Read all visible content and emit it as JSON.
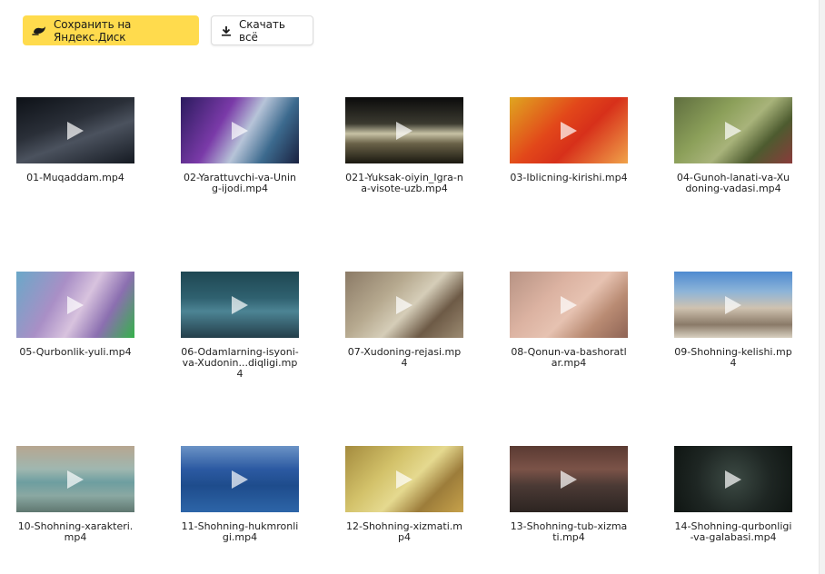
{
  "toolbar": {
    "save_label": "Сохранить на Яндекс.Диск",
    "save_icon": "yandex-disk-icon",
    "download_label": "Скачать всё",
    "download_icon": "download-icon",
    "accent_color": "#ffdb4d"
  },
  "files": [
    {
      "name": "01-Muqaddam.mp4",
      "thumb": "linear-gradient(160deg,#0d1117 0%,#2a2f38 40%,#4b525e 60%,#151a22 100%)"
    },
    {
      "name": "02-Yarattuvchi-va-Uning-ijodi.mp4",
      "thumb": "linear-gradient(120deg,#2b1b5e 0%,#7a3aa8 35%,#b7c4d8 55%,#3c6a8e 75%,#1a2140 100%)"
    },
    {
      "name": "021-Yuksak-oiyin_Igra-na-visote-uzb.mp4",
      "thumb": "linear-gradient(180deg,#0b0b0b 0%,#3b3a30 40%,#c7c2a5 55%,#6a6248 70%,#1a1810 100%)"
    },
    {
      "name": "03-Iblicning-kirishi.mp4",
      "thumb": "linear-gradient(135deg,#e0a620 0%,#e2471a 40%,#d7301a 60%,#f0a34a 100%)"
    },
    {
      "name": "04-Gunoh-lanati-va-Xudoning-vadasi.mp4",
      "thumb": "linear-gradient(135deg,#5f6e3f 0%,#8ca05a 35%,#a8b37a 55%,#4d5b2f 75%,#8a3b3b 100%)"
    },
    {
      "name": "05-Qurbonlik-yuli.mp4",
      "thumb": "linear-gradient(120deg,#6aa8c8 0%,#a98fc6 35%,#d8c3de 55%,#8b6fb0 75%,#35b24a 100%)"
    },
    {
      "name": "06-Odamlarning-isyoni-va-Xudonin...diqligi.mp4",
      "thumb": "linear-gradient(180deg,#1f4752 0%,#2f6170 40%,#4c8494 60%,#243e4a 100%)"
    },
    {
      "name": "07-Xudoning-rejasi.mp4",
      "thumb": "linear-gradient(135deg,#8b7a66 0%,#b6a98f 35%,#d5cdb8 55%,#6d5a46 75%,#9c8b72 100%)"
    },
    {
      "name": "08-Qonun-va-bashoratlar.mp4",
      "thumb": "linear-gradient(135deg,#b79384 0%,#dcb3a2 35%,#e6c2b1 55%,#b98b73 75%,#8f6455 100%)"
    },
    {
      "name": "09-Shohning-kelishi.mp4",
      "thumb": "linear-gradient(180deg,#4e8ad0 0%,#8db4d8 30%,#cfc2b0 55%,#8a7a68 80%,#d8d0c0 100%)"
    },
    {
      "name": "10-Shohning-xarakteri.mp4",
      "thumb": "linear-gradient(180deg,#b7a690 0%,#9fb7b0 35%,#6d9ea0 55%,#8aa8a2 75%,#5f7770 100%)"
    },
    {
      "name": "11-Shohning-hukmronligi.mp4",
      "thumb": "linear-gradient(180deg,#6b93c6 0%,#2c5aa2 35%,#1e4c8c 60%,#2d65a8 100%)"
    },
    {
      "name": "12-Shohning-xizmati.mp4",
      "thumb": "linear-gradient(135deg,#a48b3e 0%,#d3c26a 35%,#e5d98f 55%,#9c7c3a 75%,#c7a24b 100%)"
    },
    {
      "name": "13-Shohning-tub-xizmati.mp4",
      "thumb": "linear-gradient(180deg,#5a3a32 0%,#7b5348 35%,#4b3a35 60%,#2c2421 100%)"
    },
    {
      "name": "14-Shohning-qurbonligi-va-galabasi.mp4",
      "thumb": "radial-gradient(circle at 50% 50%,#3d4b45 0%,#1e2623 55%,#0f1512 100%)"
    }
  ]
}
